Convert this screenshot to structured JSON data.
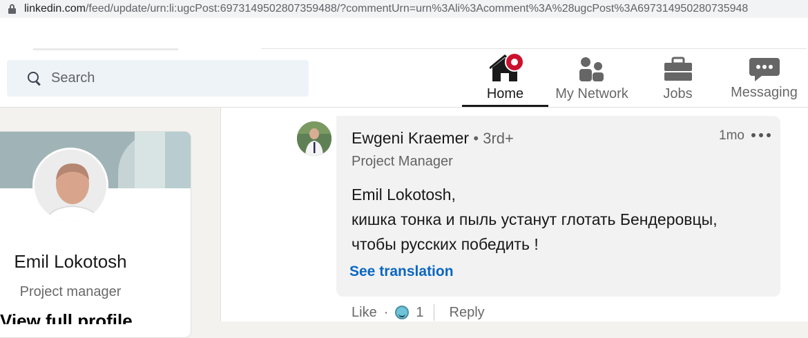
{
  "browser": {
    "url_domain": "linkedin.com",
    "url_rest": "/feed/update/urn:li:ugcPost:6973149502807359488/?commentUrn=urn%3Ali%3Acomment%3A%28ugcPost%3A697314950280735948"
  },
  "nav": {
    "search_placeholder": "Search",
    "items": [
      {
        "label": "Home",
        "icon": "home-icon",
        "active": true
      },
      {
        "label": "My Network",
        "icon": "people-icon"
      },
      {
        "label": "Jobs",
        "icon": "briefcase-icon"
      },
      {
        "label": "Messaging",
        "icon": "chat-icon"
      }
    ],
    "notification_color": "#cb112d"
  },
  "profile": {
    "name": "Emil Lokotosh",
    "title": "Project manager",
    "view_profile_peek": "View full profile"
  },
  "comment": {
    "author": "Ewgeni Kraemer",
    "degree": "• 3rd+",
    "headline": "Project Manager",
    "time": "1mo",
    "lines": [
      "Emil Lokotosh,",
      "кишка тонка и пыль устанут глотать Бендеровцы,",
      "чтобы русских победить !"
    ],
    "translate_label": "See translation",
    "actions": {
      "like": "Like",
      "dot": "·",
      "reaction_count": "1",
      "reply": "Reply"
    }
  },
  "colors": {
    "link_blue": "#0a66c2",
    "page_bg": "#f3f2ef",
    "bubble_bg": "#f2f2f2"
  }
}
